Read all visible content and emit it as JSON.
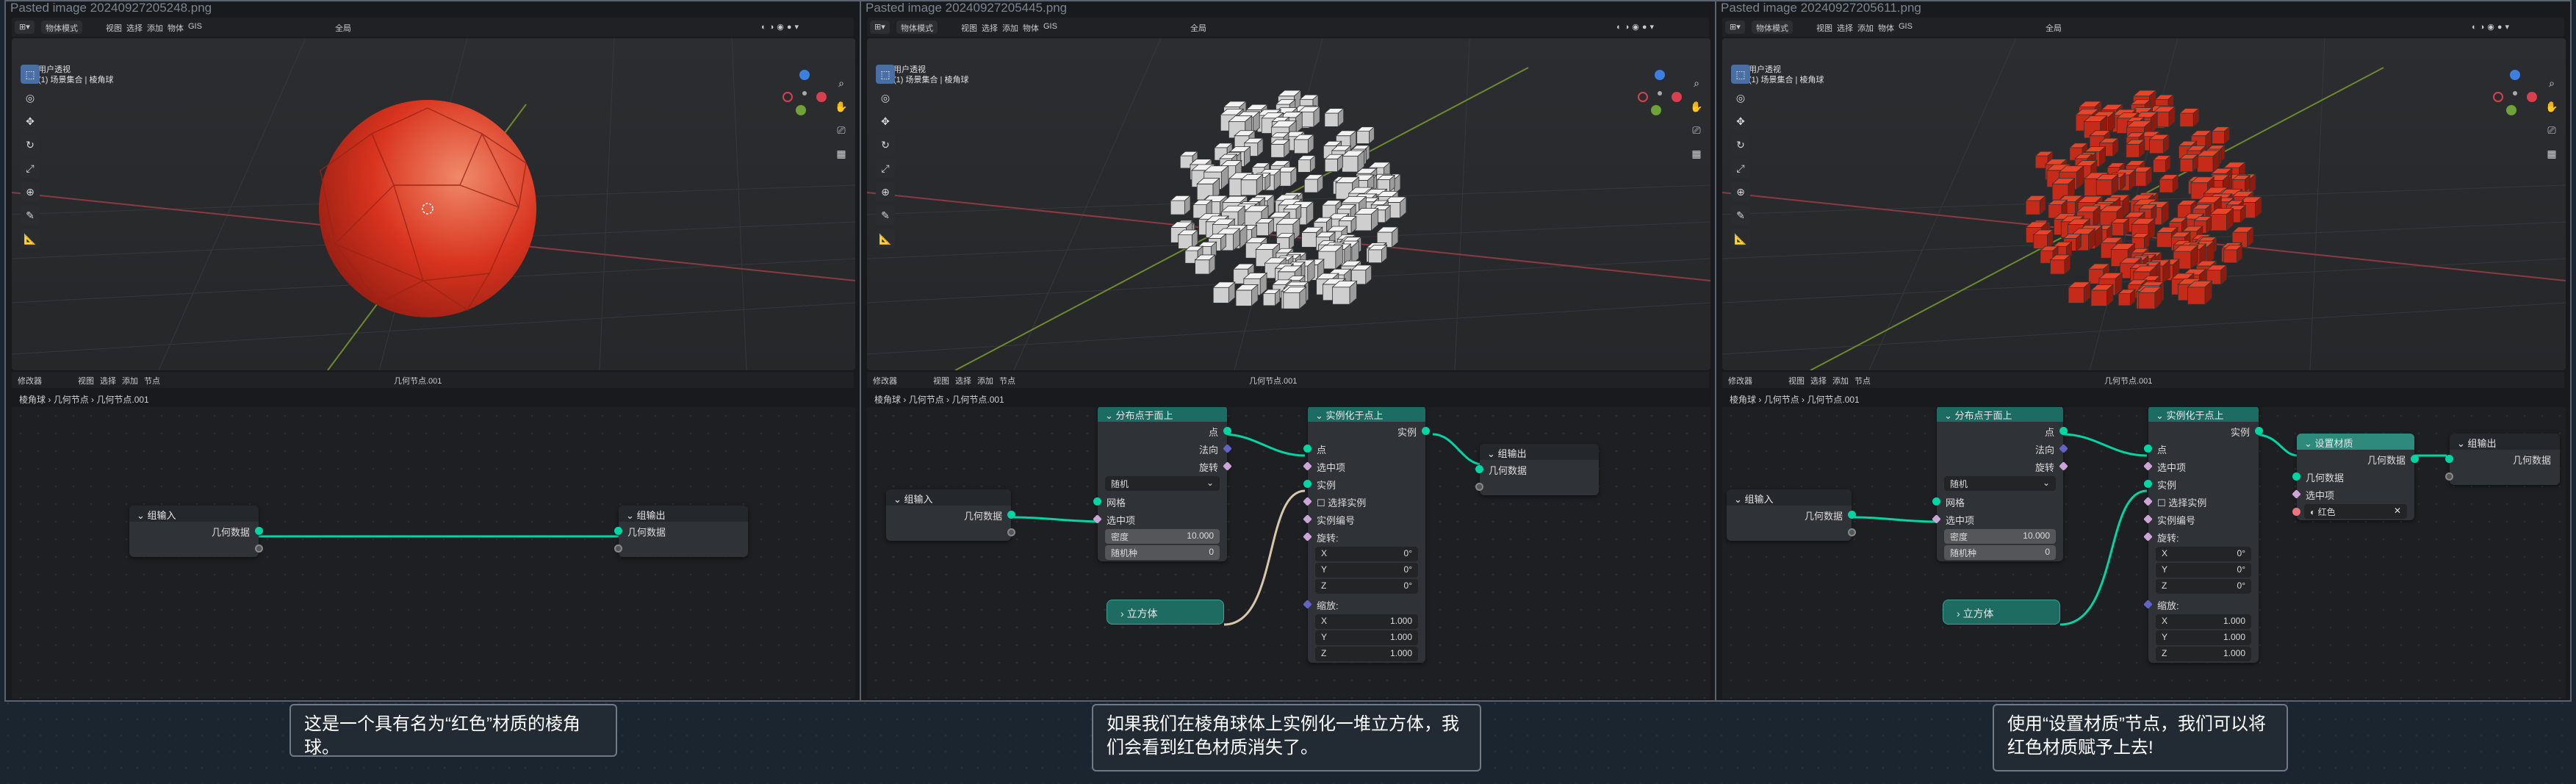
{
  "panels": [
    {
      "file_title": "Pasted image 20240927205248.png",
      "mode": "物体模式",
      "menus": [
        "视图",
        "选择",
        "添加",
        "物体",
        "GIS"
      ],
      "global": "全局",
      "options": "选项",
      "view_name": "用户透视",
      "collection": "(1) 场景集合 | 棱角球",
      "editor_type": "修改器",
      "ne_menus": [
        "视图",
        "选择",
        "添加",
        "节点"
      ],
      "tree_name": "几何节点.001",
      "breadcrumb": [
        "棱角球",
        "几何节点",
        "几何节点.001"
      ],
      "scene": "sphere"
    },
    {
      "file_title": "Pasted image 20240927205445.png",
      "mode": "物体模式",
      "menus": [
        "视图",
        "选择",
        "添加",
        "物体",
        "GIS"
      ],
      "global": "全局",
      "options": "选项",
      "view_name": "用户透视",
      "collection": "(1) 场景集合 | 棱角球",
      "editor_type": "修改器",
      "ne_menus": [
        "视图",
        "选择",
        "添加",
        "节点"
      ],
      "tree_name": "几何节点.001",
      "breadcrumb": [
        "棱角球",
        "几何节点",
        "几何节点.001"
      ],
      "scene": "grey-cubes"
    },
    {
      "file_title": "Pasted image 20240927205611.png",
      "mode": "物体模式",
      "menus": [
        "视图",
        "选择",
        "添加",
        "物体",
        "GIS"
      ],
      "global": "全局",
      "options": "选项",
      "view_name": "用户透视",
      "collection": "(1) 场景集合 | 棱角球",
      "editor_type": "修改器",
      "ne_menus": [
        "视图",
        "选择",
        "添加",
        "节点"
      ],
      "tree_name": "几何节点.001",
      "breadcrumb": [
        "棱角球",
        "几何节点",
        "几何节点.001"
      ],
      "scene": "red-cubes"
    }
  ],
  "nodes": {
    "group_input": "组输入",
    "group_output": "组输出",
    "geometry": "几何数据",
    "distribute": "分布点于面上",
    "points": "点",
    "normal": "法向",
    "rotation": "旋转",
    "random": "随机",
    "mesh": "网格",
    "selection": "选中项",
    "density": "密度",
    "density_val": "10.000",
    "seed": "随机种",
    "seed_val": "0",
    "instance_on_points": "实例化于点上",
    "instance": "实例",
    "pick_instance": "选择实例",
    "instance_index": "实例编号",
    "rotation_label": "旋转:",
    "scale_label": "缩放:",
    "x": "X",
    "y": "Y",
    "z": "Z",
    "rot_val": "0°",
    "scale_val": "1.000",
    "cube": "立方体",
    "set_material": "设置材质",
    "material": "材质",
    "material_name": "红色"
  },
  "captions": [
    "这是一个具有名为“红色”材质的棱角球。",
    "如果我们在棱角球体上实例化一堆立方体，我们会看到红色材质消失了。",
    "使用“设置材质”节点，我们可以将红色材质赋予上去!"
  ],
  "colors": {
    "accent_geo": "#00d6a3",
    "red_material": "#d9341f",
    "grey_cube": "#d6d6d6"
  }
}
